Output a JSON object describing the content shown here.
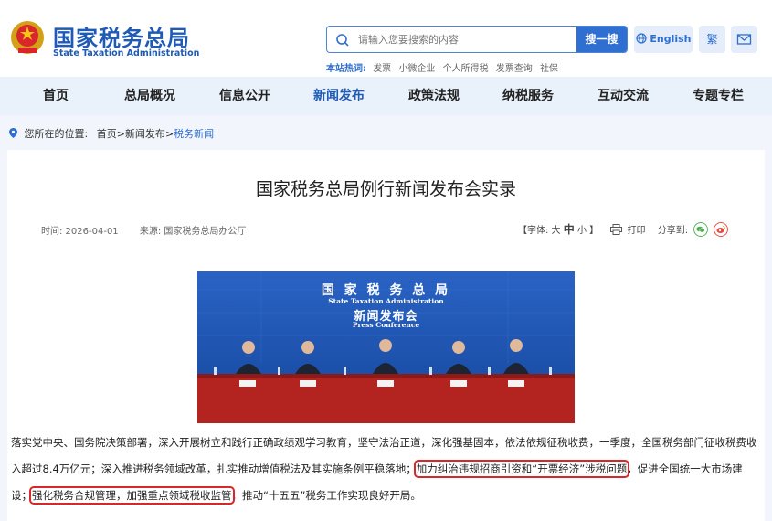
{
  "header": {
    "site_name_cn": "国家税务总局",
    "site_name_en": "State Taxation Administration",
    "search_placeholder": "请输入您要搜索的内容",
    "search_button": "搜一搜",
    "english_button": "English",
    "traditional_button": "繁",
    "hot_label": "本站热词:",
    "hot_keywords": [
      "发票",
      "小微企业",
      "个人所得税",
      "发票查询",
      "社保"
    ]
  },
  "nav": {
    "items": [
      "首页",
      "总局概况",
      "信息公开",
      "新闻发布",
      "政策法规",
      "纳税服务",
      "互动交流",
      "专题专栏"
    ],
    "active": "新闻发布"
  },
  "breadcrumb": {
    "label": "您所在的位置:",
    "home": "首页",
    "section": "新闻发布",
    "current": "税务新闻",
    "sep": ">"
  },
  "article": {
    "title": "国家税务总局例行新闻发布会实录",
    "date": "时间:  2026-04-01",
    "source": "来源:  国家税务总局办公厅",
    "font_label_open": "【字体: 大",
    "font_mid": "中",
    "font_label_close": "小 】",
    "print_label": "打印",
    "share_label": "分享到:",
    "photo": {
      "cn_title": "国 家 税 务 总 局",
      "en_title": "State Taxation Administration",
      "cn_subtitle": "新闻发布会",
      "en_subtitle": "Press Conference"
    },
    "paragraph_1": "落实党中央、国务院决策部署，深入开展树立和践行正确政绩观学习教育，坚守法治正道，深化强基固本，依法依规征税收费，一季度，全国税务部门征收税费收入超过8.4万亿元；深入推进税务领域改革，扎实推动增值税法及其实施条例平稳落地；",
    "highlight_1": "加力纠治违规招商引资和“开票经济”涉税问题",
    "paragraph_2": "，促进全国统一大市场建设；",
    "highlight_2": "强化税务合规管理，加强重点领域税收监管",
    "paragraph_3": "，推动“十五五”税务工作实现良好开局。"
  },
  "colors": {
    "brand_blue": "#1f5bb5",
    "button_blue": "#2f6fd1",
    "nav_bg": "#e9f1fb",
    "highlight_red": "#d9262b"
  }
}
